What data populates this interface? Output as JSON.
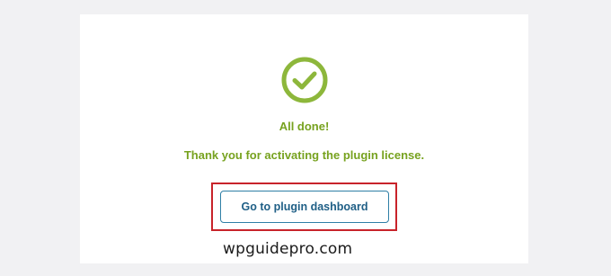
{
  "success_panel": {
    "icon": "check-circle-icon",
    "title": "All done!",
    "message": "Thank you for activating the plugin license.",
    "dashboard_button_label": "Go to plugin dashboard"
  },
  "watermark": "wpguidepro.com",
  "colors": {
    "accent_green": "#77a21f",
    "button_border": "#2f7fa6",
    "button_text": "#1f5f86",
    "highlight_red": "#c8232a",
    "page_background": "#f1f1f3"
  }
}
